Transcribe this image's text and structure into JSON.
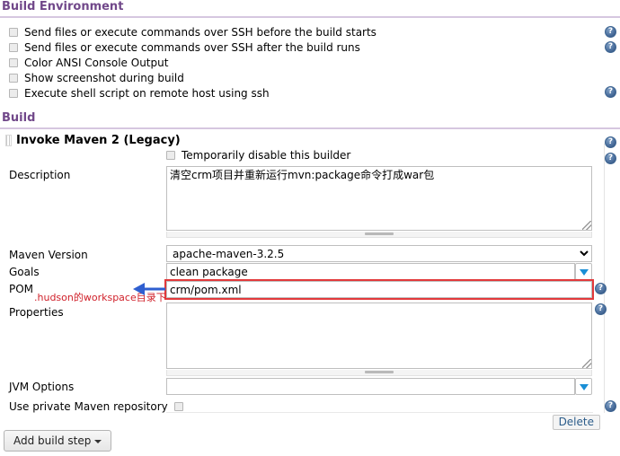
{
  "sections": {
    "build_environment": {
      "title": "Build Environment",
      "options": [
        {
          "label": "Send files or execute commands over SSH before the build starts",
          "checked": false,
          "has_help": true
        },
        {
          "label": "Send files or execute commands over SSH after the build runs",
          "checked": false,
          "has_help": true
        },
        {
          "label": "Color ANSI Console Output",
          "checked": false,
          "has_help": false
        },
        {
          "label": "Show screenshot during build",
          "checked": false,
          "has_help": false
        },
        {
          "label": "Execute shell script on remote host using ssh",
          "checked": false,
          "has_help": true
        }
      ]
    },
    "build": {
      "title": "Build",
      "builder": {
        "name": "Invoke Maven 2 (Legacy)",
        "disable_checkbox_label": "Temporarily disable this builder",
        "disable_checked": false,
        "fields": {
          "description_label": "Description",
          "description_value": "清空crm项目并重新运行mvn:package命令打成war包",
          "maven_version_label": "Maven Version",
          "maven_version_value": "apache-maven-3.2.5",
          "goals_label": "Goals",
          "goals_value": "clean package",
          "pom_label": "POM",
          "pom_value": "crm/pom.xml",
          "properties_label": "Properties",
          "properties_value": "",
          "jvm_options_label": "JVM Options",
          "jvm_options_value": "",
          "private_repo_label": "Use private Maven repository",
          "private_repo_checked": false
        },
        "delete_label": "Delete"
      },
      "add_build_step_label": "Add build step"
    }
  },
  "annotation": {
    "text": ".hudson的workspace目录下",
    "text_color": "#d0202a",
    "arrow_color": "#2f5fd0",
    "highlight_color": "#e2393b"
  },
  "icons": {
    "help": "?",
    "help_title": "Help for feature"
  }
}
